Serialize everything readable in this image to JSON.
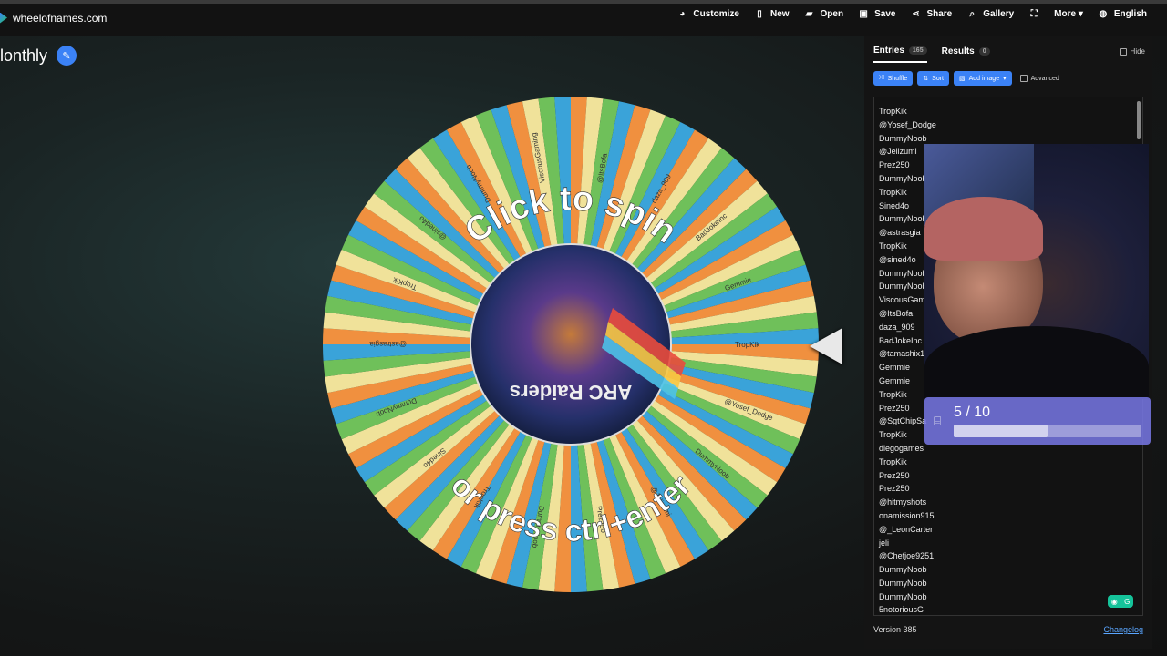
{
  "site": {
    "name": "wheelofnames.com"
  },
  "nav": [
    {
      "label": "Customize",
      "icon": "palette-icon",
      "glyph": "◕"
    },
    {
      "label": "New",
      "icon": "file-icon",
      "glyph": "▯"
    },
    {
      "label": "Open",
      "icon": "folder-icon",
      "glyph": "▰"
    },
    {
      "label": "Save",
      "icon": "save-icon",
      "glyph": "▣"
    },
    {
      "label": "Share",
      "icon": "share-icon",
      "glyph": "⋖"
    },
    {
      "label": "Gallery",
      "icon": "search-icon",
      "glyph": "⌕"
    },
    {
      "label": "",
      "icon": "fullscreen-icon",
      "glyph": "⛶"
    },
    {
      "label": "More ▾",
      "icon": "",
      "glyph": ""
    },
    {
      "label": "English",
      "icon": "globe-icon",
      "glyph": "◍"
    }
  ],
  "wheel": {
    "title": "lonthly",
    "spin_text": "Click to spin",
    "press_text": "or press ctrl+enter",
    "center_image_text": "ARC Raiders",
    "segment_colors": [
      "#f0903f",
      "#f0e29a",
      "#6fc05a",
      "#3aa3d9"
    ],
    "sample_labels": [
      "TropKik",
      "@Yosef_Dodge",
      "DummyNoob",
      "@Jelizumi",
      "Prez250",
      "DummyNoob",
      "TropKik",
      "Sined4o",
      "DummyNoob",
      "@astrasgia",
      "TropKik",
      "@sined4o",
      "DummyNoob",
      "ViscousGaming",
      "@ItsBofa",
      "daza_909",
      "BadJokeInc",
      "Gemmie"
    ]
  },
  "panel": {
    "tabs": [
      {
        "label": "Entries",
        "count": "165"
      },
      {
        "label": "Results",
        "count": "0"
      }
    ],
    "hide_label": "Hide",
    "buttons": [
      {
        "label": "Shuffle",
        "icon": "shuffle-icon",
        "glyph": "⤮"
      },
      {
        "label": "Sort",
        "icon": "sort-icon",
        "glyph": "⇅"
      },
      {
        "label": "Add image",
        "icon": "image-icon",
        "glyph": "▧"
      }
    ],
    "advanced_label": "Advanced",
    "entries": [
      "TropKik",
      "@Yosef_Dodge",
      "DummyNoob",
      "@Jelizumi",
      "Prez250",
      "DummyNoob",
      "TropKik",
      "Sined4o",
      "DummyNoob",
      "@astrasgia",
      "TropKik",
      "@sined4o",
      "DummyNoob",
      "DummyNoob",
      "ViscousGaming",
      "@ItsBofa",
      "daza_909",
      "BadJokeInc",
      "@tamashix12",
      "Gemmie",
      "Gemmie",
      "TropKik",
      "Prez250",
      "@SgtChipSa",
      "TropKik",
      "diegogames",
      "TropKik",
      "Prez250",
      "Prez250",
      "@hitmyshots",
      "onamission915",
      "@_LeonCarter",
      "jeli",
      "@Chefjoe9251",
      "DummyNoob",
      "DummyNoob",
      "DummyNoob",
      "5notoriousG"
    ],
    "version": "Version 385",
    "changelog": "Changelog"
  },
  "goal": {
    "text": "5 / 10",
    "progress": 0.5
  }
}
